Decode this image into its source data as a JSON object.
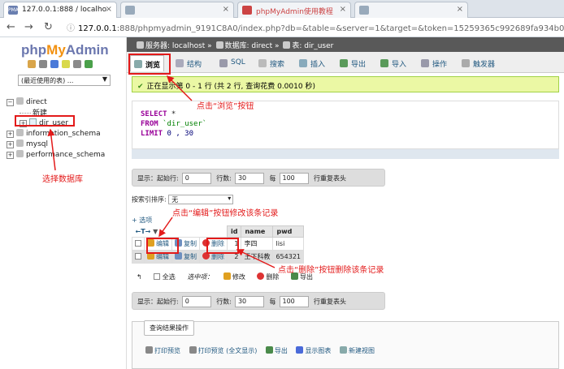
{
  "browser": {
    "tabs": [
      {
        "title": "127.0.0.1:888 / localho",
        "favicon": "PMA"
      },
      {
        "title": "",
        "favicon": ""
      },
      {
        "title": "phpMyAdmin使用教程",
        "favicon": ""
      },
      {
        "title": "",
        "favicon": ""
      }
    ],
    "url_host": "127.0.0.1",
    "url_rest": ":888/phpmyadmin_9191C8A0/index.php?db=&table=&server=1&target=&token=15259365c992689fa934b0..."
  },
  "left": {
    "recent_label": "(最近使用的表) ...",
    "tree": [
      {
        "label": "direct"
      },
      {
        "label": "新建"
      },
      {
        "label": "dir_user"
      },
      {
        "label": "information_schema"
      },
      {
        "label": "mysql"
      },
      {
        "label": "performance_schema"
      }
    ]
  },
  "breadcrumb": {
    "server": "服务器: localhost",
    "db": "数据库: direct",
    "table": "表: dir_user"
  },
  "menu": [
    {
      "label": "浏览"
    },
    {
      "label": "结构"
    },
    {
      "label": "SQL"
    },
    {
      "label": "搜索"
    },
    {
      "label": "插入"
    },
    {
      "label": "导出"
    },
    {
      "label": "导入"
    },
    {
      "label": "操作"
    },
    {
      "label": "触发器"
    }
  ],
  "success_msg": "正在显示第 0 - 1 行 (共 2 行, 查询花费 0.0010 秒)",
  "sql": {
    "select": "SELECT",
    "star": " *",
    "from": "FROM",
    "table": " `dir_user`",
    "limit": "LIMIT",
    "limit_val": " 0 , 30"
  },
  "nav": {
    "show": "显示：",
    "start_label": "起始行:",
    "start_value": "0",
    "rows_label": "行数:",
    "rows_value": "30",
    "per_label": "每",
    "per_value": "100",
    "repeat_label": "行重复表头"
  },
  "sort": {
    "label": "按索引排序:",
    "value": "无"
  },
  "options_label": "+ 选项",
  "table": {
    "nav_arrows": "←T→",
    "columns": [
      "id",
      "name",
      "pwd"
    ],
    "rows": [
      {
        "id": "1",
        "name": "李四",
        "pwd": "lisi"
      },
      {
        "id": "2",
        "name": "王下科教",
        "pwd": "654321"
      }
    ],
    "actions": {
      "edit": "编辑",
      "copy": "复制",
      "delete": "删除"
    }
  },
  "bulk": {
    "select_all": "全选",
    "selected": "选中项：",
    "edit": "修改",
    "delete": "删除",
    "export": "导出"
  },
  "query_ops": {
    "legend": "查询结果操作",
    "links": [
      "打印预览",
      "打印预览 (全文显示)",
      "导出",
      "显示图表",
      "新建视图"
    ]
  },
  "annotations": {
    "browse": "点击“浏览”按钮",
    "select_db": "选择数据库",
    "edit": "点击“编辑”按钮修改该条记录",
    "delete": "点击“删除”按钮删除该条记录"
  },
  "colors": {
    "annotation": "#e31a1a",
    "success_bg": "#ebf8a4",
    "breadcrumb_bg": "#595959"
  }
}
